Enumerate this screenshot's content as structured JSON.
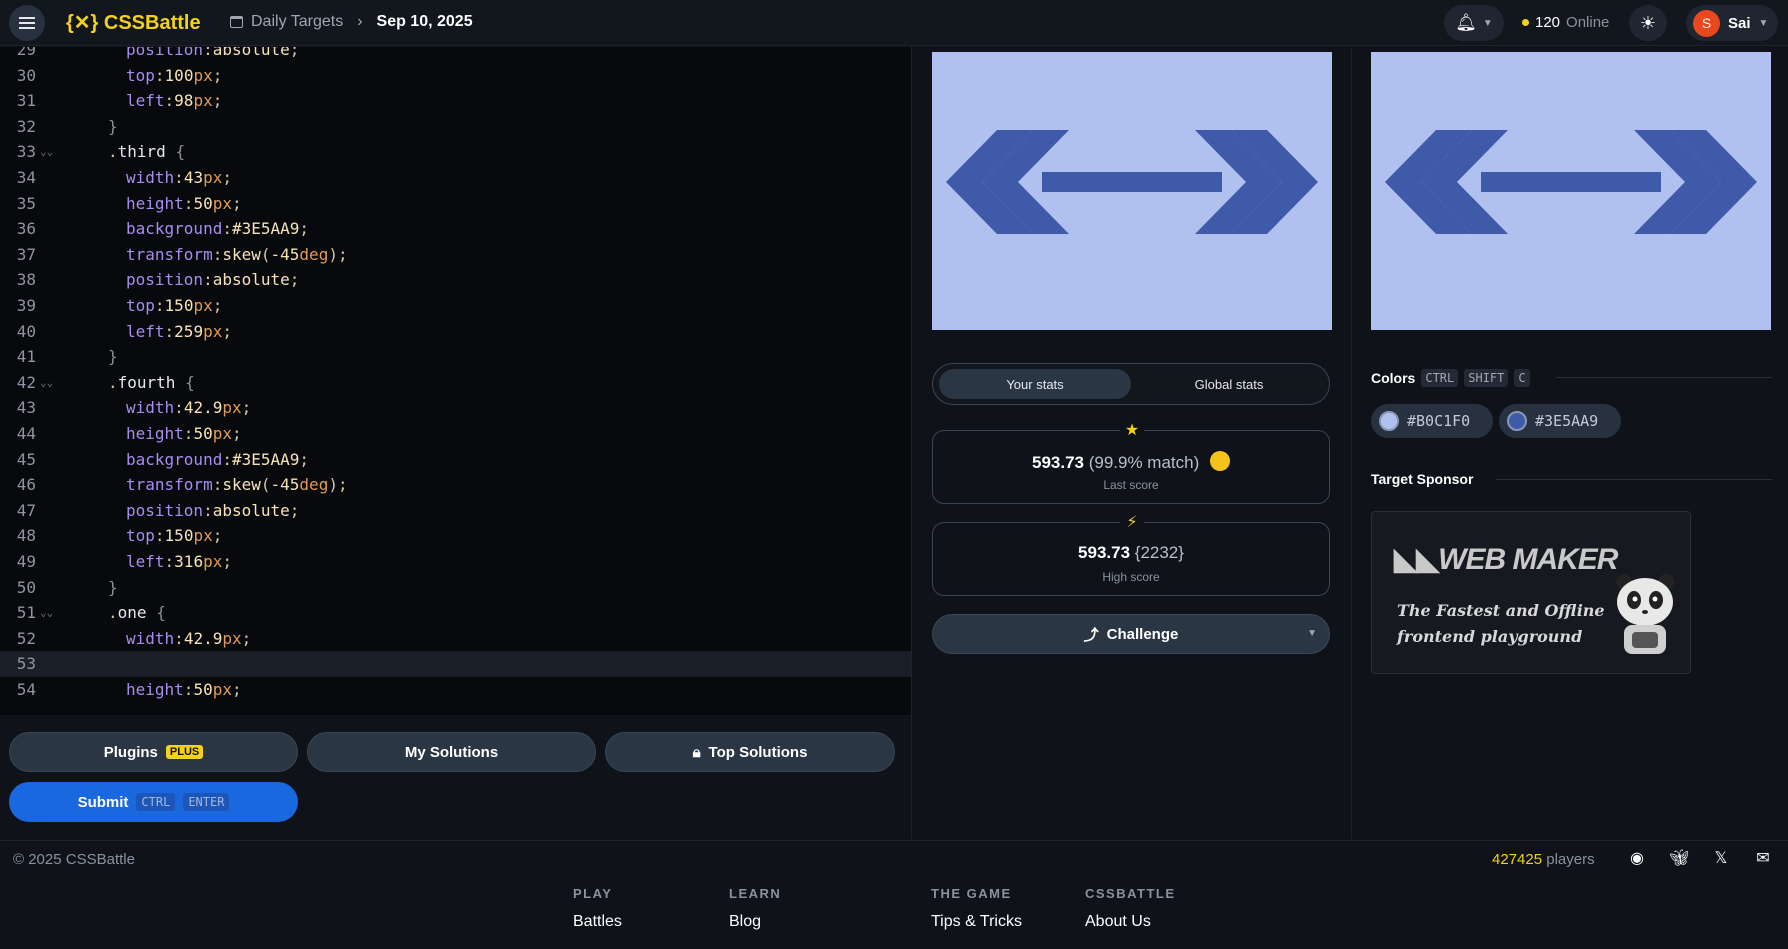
{
  "header": {
    "logo": "{✕} CSSBattle",
    "breadcrumb_parent": "Daily Targets",
    "breadcrumb_current": "Sep 10, 2025",
    "online_count": "120",
    "online_label": "Online",
    "user_initial": "S",
    "user_name": "Sai"
  },
  "editor": {
    "lines": [
      {
        "n": "29",
        "fold": false,
        "html": "<span class='prop'>position</span><span class='punc'>:</span><span class='val'>absolute</span><span class='punc'>;</span>",
        "indent": 1
      },
      {
        "n": "30",
        "html": "<span class='prop'>top</span><span class='punc'>:</span><span class='val'>100</span><span class='unit'>px</span><span class='punc'>;</span>",
        "indent": 1
      },
      {
        "n": "31",
        "html": "<span class='prop'>left</span><span class='punc'>:</span><span class='val'>98</span><span class='unit'>px</span><span class='punc'>;</span>",
        "indent": 1
      },
      {
        "n": "32",
        "html": "<span class='brace'>}</span>",
        "indent": 0
      },
      {
        "n": "33",
        "fold": true,
        "html": "<span class='punc'>.</span><span class='sel'>third</span> <span class='brace'>{</span>",
        "indent": 0
      },
      {
        "n": "34",
        "html": "<span class='prop'>width</span><span class='punc'>:</span><span class='val'>43</span><span class='unit'>px</span><span class='punc'>;</span>",
        "indent": 1
      },
      {
        "n": "35",
        "html": "<span class='prop'>height</span><span class='punc'>:</span><span class='val'>50</span><span class='unit'>px</span><span class='punc'>;</span>",
        "indent": 1
      },
      {
        "n": "36",
        "html": "<span class='prop'>background</span><span class='punc'>:</span><span class='val'>#3E5AA9</span><span class='punc'>;</span>",
        "indent": 1
      },
      {
        "n": "37",
        "html": "<span class='prop'>transform</span><span class='punc'>:</span><span class='val'>skew</span><span class='punc'>(</span><span class='val'>-45</span><span class='unit'>deg</span><span class='punc'>);</span>",
        "indent": 1
      },
      {
        "n": "38",
        "html": "<span class='prop'>position</span><span class='punc'>:</span><span class='val'>absolute</span><span class='punc'>;</span>",
        "indent": 1
      },
      {
        "n": "39",
        "html": "<span class='prop'>top</span><span class='punc'>:</span><span class='val'>150</span><span class='unit'>px</span><span class='punc'>;</span>",
        "indent": 1
      },
      {
        "n": "40",
        "html": "<span class='prop'>left</span><span class='punc'>:</span><span class='val'>259</span><span class='unit'>px</span><span class='punc'>;</span>",
        "indent": 1
      },
      {
        "n": "41",
        "html": "<span class='brace'>}</span>",
        "indent": 0
      },
      {
        "n": "42",
        "fold": true,
        "html": "<span class='punc'>.</span><span class='sel'>fourth</span> <span class='brace'>{</span>",
        "indent": 0
      },
      {
        "n": "43",
        "html": "<span class='prop'>width</span><span class='punc'>:</span><span class='val'>42.9</span><span class='unit'>px</span><span class='punc'>;</span>",
        "indent": 1
      },
      {
        "n": "44",
        "html": "<span class='prop'>height</span><span class='punc'>:</span><span class='val'>50</span><span class='unit'>px</span><span class='punc'>;</span>",
        "indent": 1
      },
      {
        "n": "45",
        "html": "<span class='prop'>background</span><span class='punc'>:</span><span class='val'>#3E5AA9</span><span class='punc'>;</span>",
        "indent": 1
      },
      {
        "n": "46",
        "html": "<span class='prop'>transform</span><span class='punc'>:</span><span class='val'>skew</span><span class='punc'>(</span><span class='val'>-45</span><span class='unit'>deg</span><span class='punc'>);</span>",
        "indent": 1
      },
      {
        "n": "47",
        "html": "<span class='prop'>position</span><span class='punc'>:</span><span class='val'>absolute</span><span class='punc'>;</span>",
        "indent": 1
      },
      {
        "n": "48",
        "html": "<span class='prop'>top</span><span class='punc'>:</span><span class='val'>150</span><span class='unit'>px</span><span class='punc'>;</span>",
        "indent": 1
      },
      {
        "n": "49",
        "html": "<span class='prop'>left</span><span class='punc'>:</span><span class='val'>316</span><span class='unit'>px</span><span class='punc'>;</span>",
        "indent": 1
      },
      {
        "n": "50",
        "html": "<span class='brace'>}</span>",
        "indent": 0
      },
      {
        "n": "51",
        "fold": true,
        "html": "<span class='punc'>.</span><span class='sel'>one</span> <span class='brace'>{</span>",
        "indent": 0
      },
      {
        "n": "52",
        "html": "<span class='prop'>width</span><span class='punc'>:</span><span class='val'>42.9</span><span class='unit'>px</span><span class='punc'>;</span>",
        "indent": 1
      },
      {
        "n": "53",
        "active": true,
        "html": "",
        "indent": 1
      },
      {
        "n": "54",
        "html": "<span class='prop'>height</span><span class='punc'>:</span><span class='val'>50</span><span class='unit'>px</span><span class='punc'>;</span>",
        "indent": 1
      }
    ]
  },
  "actions": {
    "plugins_label": "Plugins",
    "plus_badge": "PLUS",
    "my_solutions_label": "My Solutions",
    "top_solutions_label": "Top Solutions",
    "submit_label": "Submit",
    "submit_kbd_1": "CTRL",
    "submit_kbd_2": "ENTER"
  },
  "stats": {
    "tab_your": "Your stats",
    "tab_global": "Global stats",
    "last_score": "593.73",
    "last_match": "(99.9% match)",
    "last_label": "Last score",
    "high_score": "593.73",
    "high_chars": "{2232}",
    "high_label": "High score",
    "challenge_label": "Challenge"
  },
  "colors": {
    "title": "Colors",
    "kbd": [
      "CTRL",
      "SHIFT",
      "C"
    ],
    "swatches": [
      {
        "hex": "#B0C1F0",
        "label": "#B0C1F0"
      },
      {
        "hex": "#3E5AA9",
        "label": "#3E5AA9"
      }
    ]
  },
  "sponsor": {
    "title": "Target Sponsor",
    "logo_text": "WEB MAKER",
    "tagline_1": "The Fastest and Offline",
    "tagline_2": "frontend playground"
  },
  "footer": {
    "copyright": "© 2025 CSSBattle",
    "players_count": "427425",
    "players_label": "players",
    "cols": [
      {
        "heading": "PLAY",
        "link": "Battles"
      },
      {
        "heading": "LEARN",
        "link": "Blog"
      },
      {
        "heading": "THE GAME",
        "link": "Tips & Tricks"
      },
      {
        "heading": "CSSBATTLE",
        "link": "About Us"
      }
    ]
  },
  "theme": {
    "target_bg": "#B0C1F0",
    "target_fg": "#3E5AA9",
    "accent": "#F4D21A",
    "submit": "#1A68E0"
  }
}
